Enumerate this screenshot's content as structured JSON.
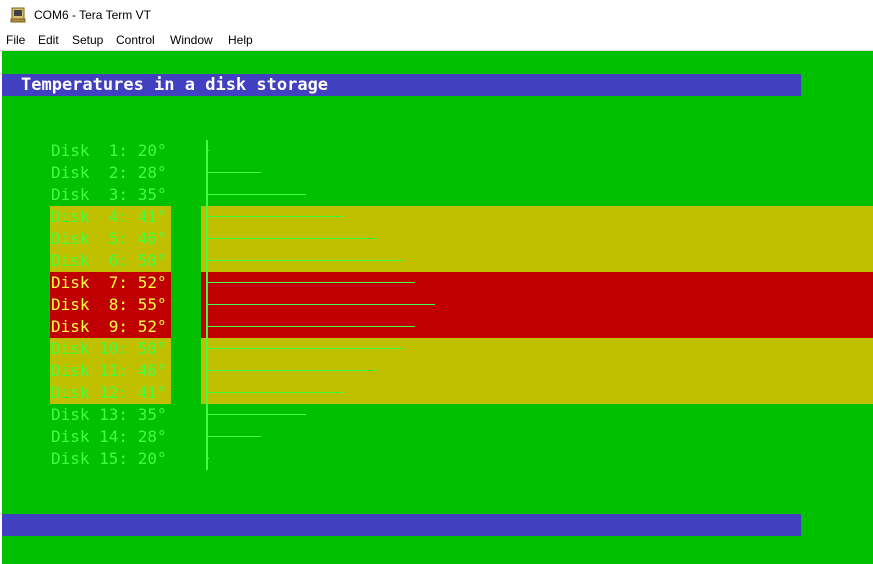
{
  "window": {
    "title": "COM6 - Tera Term VT",
    "icon": "tera-term-app-icon"
  },
  "menu": [
    "File",
    "Edit",
    "Setup",
    "Control",
    "Window",
    "Help"
  ],
  "terminal": {
    "header": "Temperatures in a disk storage",
    "footer": "",
    "colors": {
      "background": "#00c000",
      "header_bar": "#4040c0",
      "warn_band": "#c0c000",
      "hot_band": "#c00000",
      "text": "#40ff40"
    },
    "disks": [
      {
        "label": "Disk  1: 20°",
        "temp": 20,
        "level": "normal"
      },
      {
        "label": "Disk  2: 28°",
        "temp": 28,
        "level": "normal"
      },
      {
        "label": "Disk  3: 35°",
        "temp": 35,
        "level": "normal"
      },
      {
        "label": "Disk  4: 41°",
        "temp": 41,
        "level": "warn"
      },
      {
        "label": "Disk  5: 46°",
        "temp": 46,
        "level": "warn"
      },
      {
        "label": "Disk  6: 50°",
        "temp": 50,
        "level": "warn"
      },
      {
        "label": "Disk  7: 52°",
        "temp": 52,
        "level": "hot"
      },
      {
        "label": "Disk  8: 55°",
        "temp": 55,
        "level": "hot"
      },
      {
        "label": "Disk  9: 52°",
        "temp": 52,
        "level": "hot"
      },
      {
        "label": "Disk 10: 50°",
        "temp": 50,
        "level": "warn"
      },
      {
        "label": "Disk 11: 46°",
        "temp": 46,
        "level": "warn"
      },
      {
        "label": "Disk 12: 41°",
        "temp": 41,
        "level": "warn"
      },
      {
        "label": "Disk 13: 35°",
        "temp": 35,
        "level": "normal"
      },
      {
        "label": "Disk 14: 28°",
        "temp": 28,
        "level": "normal"
      },
      {
        "label": "Disk 15: 20°",
        "temp": 20,
        "level": "normal"
      }
    ]
  }
}
